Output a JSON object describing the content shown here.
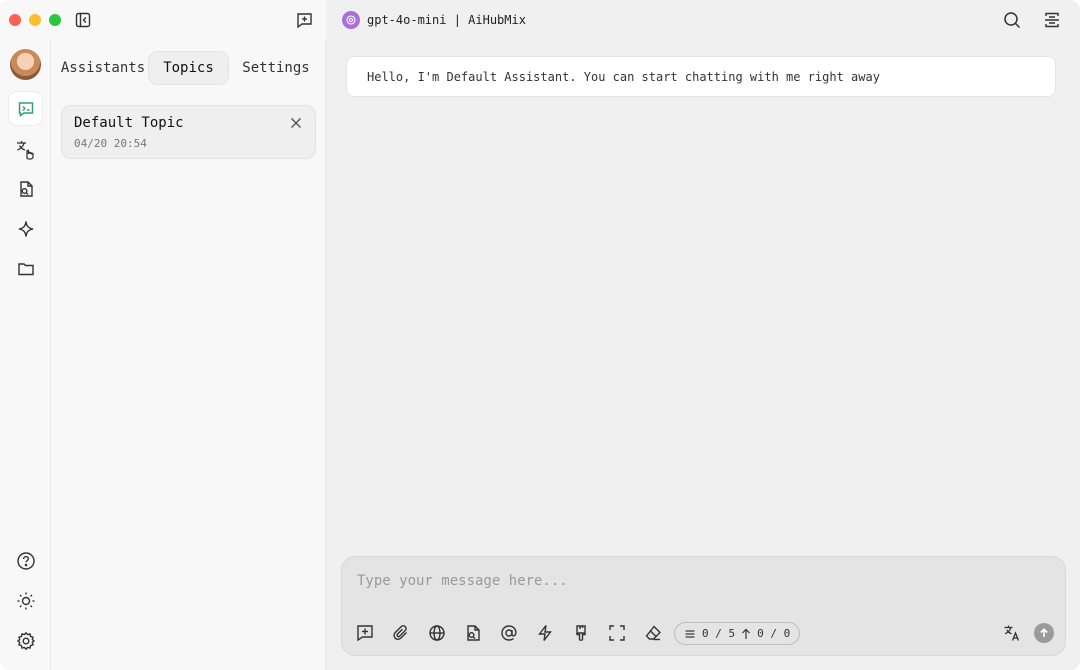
{
  "titlebar": {
    "model_label": "gpt-4o-mini | AiHubMix",
    "icons": [
      "sidebar-toggle-icon",
      "new-topic-icon",
      "search-icon",
      "layout-icon"
    ]
  },
  "rail": {
    "items": [
      {
        "name": "avatar"
      },
      {
        "name": "chat-icon",
        "active": true
      },
      {
        "name": "translate-icon"
      },
      {
        "name": "document-search-icon"
      },
      {
        "name": "sparkle-icon"
      },
      {
        "name": "folder-icon"
      },
      {
        "name": "help-icon"
      },
      {
        "name": "theme-sun-icon"
      },
      {
        "name": "settings-gear-icon"
      }
    ]
  },
  "panel": {
    "tabs": [
      {
        "label": "Assistants"
      },
      {
        "label": "Topics",
        "active": true
      },
      {
        "label": "Settings"
      }
    ],
    "topic": {
      "title": "Default Topic",
      "time": "04/20 20:54"
    }
  },
  "chat": {
    "welcome": "Hello, I'm Default Assistant. You can start chatting with me right away",
    "composer": {
      "placeholder": "Type your message here...",
      "counter_context": "0 / 5",
      "counter_tokens": "0 / 0"
    }
  },
  "colors": {
    "accent_green": "#2fa36b",
    "model_logo": "#a86fdd"
  }
}
